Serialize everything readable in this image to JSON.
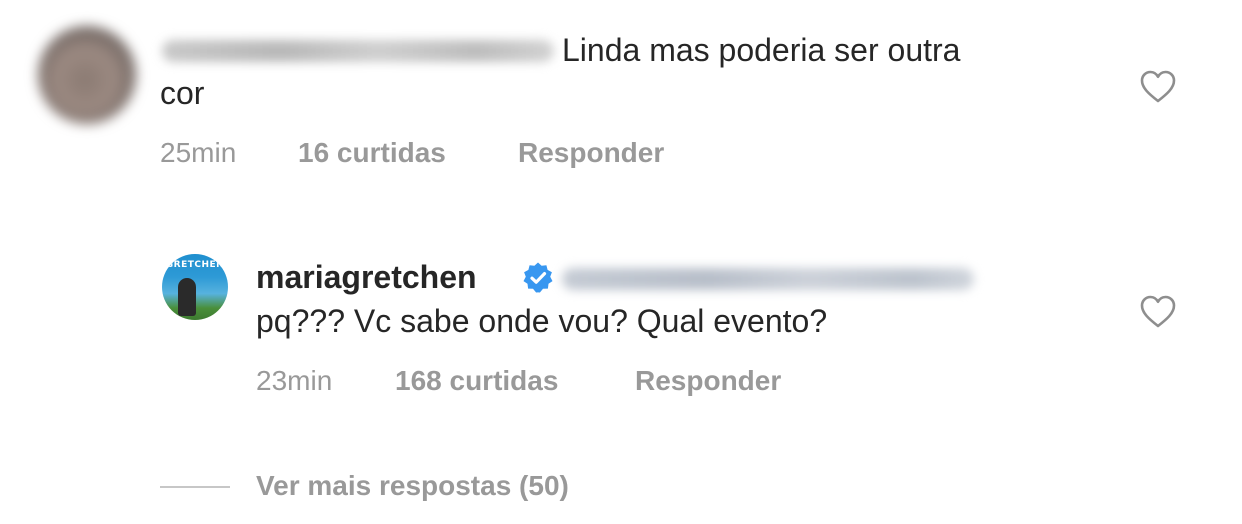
{
  "comments": [
    {
      "text_line1": "Linda mas poderia ser outra",
      "text_line2": "cor",
      "time": "25min",
      "likes": "16 curtidas",
      "reply_label": "Responder",
      "icons": {
        "avatar": "user-avatar-blurred",
        "like": "heart-outline-icon"
      }
    },
    {
      "username": "mariagretchen",
      "verified": true,
      "text": "pq??? Vc sabe onde vou?  Qual evento?",
      "time": "23min",
      "likes": "168 curtidas",
      "reply_label": "Responder",
      "avatar_text": "GRETCHEN",
      "icons": {
        "verified": "verified-badge-icon",
        "like": "heart-outline-icon"
      }
    }
  ],
  "more_replies_label": "Ver mais respostas (50)",
  "colors": {
    "text_primary": "#262626",
    "text_secondary": "#999999",
    "verified_blue": "#3897f0",
    "divider": "#c7c7c7"
  }
}
